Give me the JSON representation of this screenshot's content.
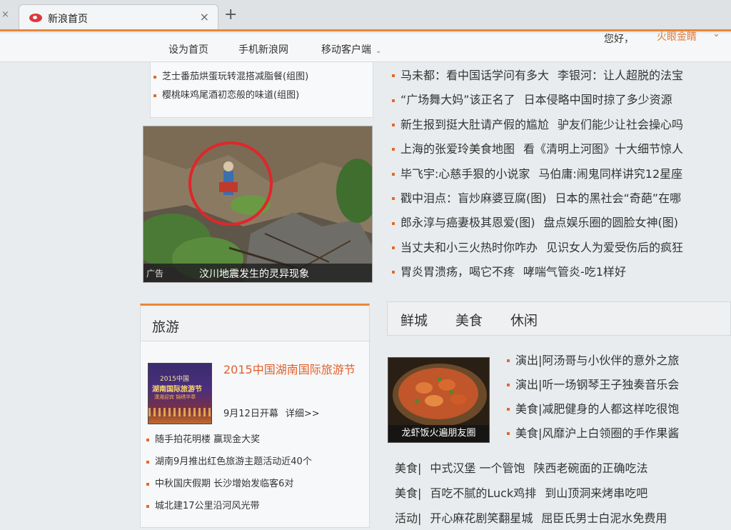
{
  "browser": {
    "tab_title": "新浪首页",
    "tab_close": "×",
    "left_close": "×",
    "new_tab": "+"
  },
  "topnav": {
    "items": [
      "设为首页",
      "手机新浪网",
      "移动客户端"
    ],
    "dropdown_arrow": "⌄",
    "greeting": "您好，",
    "username": "火眼金睛",
    "user_arrow": "⌄"
  },
  "left_top_list": [
    "芝士番茄烘蛋玩转混搭减脂餐(组图)",
    "樱桃味鸡尾酒初恋般的味道(组图)"
  ],
  "ad": {
    "tag": "广告",
    "caption": "汶川地震发生的灵异现象"
  },
  "travel": {
    "title": "旅游",
    "poster": {
      "line1": "2015中国",
      "line2": "湖南国际旅游节",
      "line3": "潇湘迎宾 锦绣华章"
    },
    "headline": "2015中国湖南国际旅游节",
    "date_text": "9月12日开幕",
    "more_text": "详细>>",
    "list": [
      "随手拍花明楼 赢现金大奖",
      "湖南9月推出红色旅游主题活动近40个",
      "中秋国庆假期 长沙增始发临客6对",
      "城北建17公里沿河风光带"
    ]
  },
  "news": [
    [
      "马未都：看中国话学问有多大",
      "李银河：让人超脱的法宝"
    ],
    [
      "“广场舞大妈”该正名了",
      "日本侵略中国时掠了多少资源"
    ],
    [
      "新生报到挺大肚请产假的尴尬",
      "驴友们能少让社会操心吗"
    ],
    [
      "上海的张爱玲美食地图",
      "看《清明上河图》十大细节惊人"
    ],
    [
      "毕飞宇:心慈手狠的小说家",
      "马伯庸:闹鬼同样讲究12星座"
    ],
    [
      "戳中泪点：盲炒麻婆豆腐(图)",
      "日本的黑社会“奇葩”在哪"
    ],
    [
      "郎永淳与癌妻极其恩爱(图)",
      "盘点娱乐圈的圆脸女神(图)"
    ],
    [
      "当丈夫和小三火热时你咋办",
      "见识女人为爱受伤后的疯狂"
    ],
    [
      "胃炎胃溃疡，喝它不疼",
      "哮喘气管炎-吃1样好"
    ]
  ],
  "food": {
    "tabs": [
      "鲜城",
      "美食",
      "休闲"
    ],
    "photo_caption": "龙虾饭火遍朋友圈",
    "list": [
      "演出|阿汤哥与小伙伴的意外之旅",
      "演出|听一场钢琴王子独奏音乐会",
      "美食|减肥健身的人都这样吃很饱",
      "美食|风靡沪上白领圈的手作果酱"
    ],
    "more": [
      [
        "美食|",
        "中式汉堡 一个管饱",
        "陕西老碗面的正确吃法"
      ],
      [
        "美食|",
        "百吃不腻的Luck鸡排",
        "到山顶洞来烤串吃吧"
      ],
      [
        "活动|",
        "开心麻花剧笑翻星城",
        "屈臣氏男士白泥水免费用"
      ]
    ]
  }
}
